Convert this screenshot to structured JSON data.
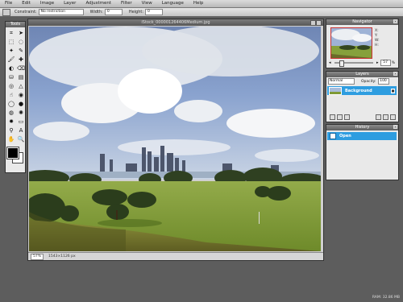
{
  "menubar": {
    "items": [
      "File",
      "Edit",
      "Image",
      "Layer",
      "Adjustment",
      "Filter",
      "View",
      "Language",
      "Help"
    ]
  },
  "options": {
    "constrain_label": "Constraint:",
    "constrain_value": "No restriction",
    "width_label": "Width:",
    "width_value": "0",
    "height_label": "Height:",
    "height_value": "0"
  },
  "tools": {
    "title": "Tools",
    "icons": [
      "crop-icon",
      "move-icon",
      "marquee-icon",
      "lasso-icon",
      "wand-icon",
      "pencil-icon",
      "brush-icon",
      "clone-icon",
      "color-replace-icon",
      "eraser-icon",
      "fill-icon",
      "gradient-icon",
      "blur-icon",
      "sharpen-icon",
      "smudge-icon",
      "sponge-icon",
      "dodge-icon",
      "burn-icon",
      "redeye-icon",
      "bloat-icon",
      "pinch-icon",
      "shape-icon",
      "picker-icon",
      "type-icon",
      "hand-icon",
      "zoom-icon"
    ],
    "glyphs": [
      "⌗",
      "➤",
      "⬚",
      "◌",
      "✦",
      "✎",
      "🖌",
      "✚",
      "◐",
      "⌫",
      "⛁",
      "▤",
      "◎",
      "△",
      "☝",
      "◉",
      "◯",
      "●",
      "◍",
      "✺",
      "✹",
      "▭",
      "⚲",
      "A",
      "✋",
      "🔍"
    ]
  },
  "document": {
    "title": "iStock_000001264406Medium.jpg",
    "zoom": "57",
    "zoom_unit": "%",
    "dimensions": "1543×1126 px"
  },
  "navigator": {
    "title": "Navigator",
    "x_label": "X:",
    "y_label": "Y:",
    "w_label": "W:",
    "h_label": "H:",
    "zoom_value": "57",
    "zoom_unit": "%"
  },
  "layers": {
    "title": "Layers",
    "blend_mode": "Normal",
    "opacity_label": "Opacity:",
    "opacity_value": "100",
    "items": [
      {
        "name": "Background"
      }
    ]
  },
  "history": {
    "title": "History",
    "items": [
      {
        "label": "Open"
      }
    ]
  },
  "footer": {
    "ram": "RAM: 32.86 MB"
  },
  "colors": {
    "selection": "#2e9de0",
    "workspace": "#5d5d5d",
    "foreground_swatch": "#000000",
    "background_swatch": "#ffffff"
  }
}
